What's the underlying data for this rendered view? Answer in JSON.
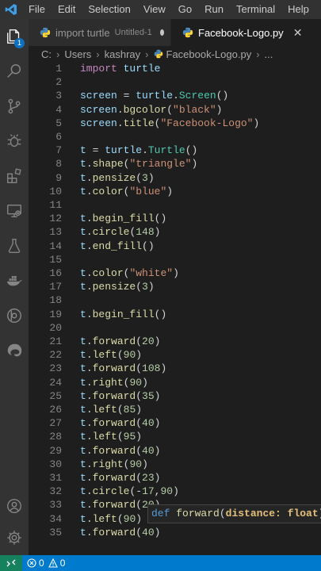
{
  "menu": [
    "File",
    "Edit",
    "Selection",
    "View",
    "Go",
    "Run",
    "Terminal",
    "Help"
  ],
  "activity_bar": {
    "explorer_badge": "1"
  },
  "tabs": [
    {
      "label": "import turtle",
      "description": "Untitled-1",
      "state": "unsaved"
    },
    {
      "label": "Facebook-Logo.py",
      "state": "active"
    }
  ],
  "breadcrumb": [
    "C:",
    "Users",
    "kashray",
    "Facebook-Logo.py",
    "..."
  ],
  "code_lines": [
    "1",
    "2",
    "3",
    "4",
    "5",
    "6",
    "7",
    "8",
    "9",
    "10",
    "11",
    "12",
    "13",
    "14",
    "15",
    "16",
    "17",
    "18",
    "19",
    "20",
    "21",
    "22",
    "23",
    "24",
    "25",
    "26",
    "27",
    "28",
    "29",
    "30",
    "31",
    "32",
    "33",
    "34",
    "35"
  ],
  "code": [
    "import turtle",
    "",
    "screen = turtle.Screen()",
    "screen.bgcolor(\"black\")",
    "screen.title(\"Facebook-Logo\")",
    "",
    "t = turtle.Turtle()",
    "t.shape(\"triangle\")",
    "t.pensize(3)",
    "t.color(\"blue\")",
    "",
    "t.begin_fill()",
    "t.circle(148)",
    "t.end_fill()",
    "",
    "t.color(\"white\")",
    "t.pensize(3)",
    "",
    "t.begin_fill()",
    "",
    "t.forward(20)",
    "t.left(90)",
    "t.forward(108)",
    "t.right(90)",
    "t.forward(35)",
    "t.left(85)",
    "t.forward(40)",
    "t.left(95)",
    "t.forward(40)",
    "t.right(90)",
    "t.forward(23)",
    "t.circle(-17,90)",
    "t.forward(20)",
    "t.left(90)",
    "t.forward(40)"
  ],
  "signature_help": "def forward(distance: float) ->",
  "status": {
    "errors": "0",
    "warnings": "0"
  },
  "colors": {
    "accent": "#007acc",
    "keyword": "#c586c0",
    "function": "#dcdcaa",
    "string": "#ce9178",
    "number": "#b5cea8",
    "variable": "#9cdcfe"
  }
}
